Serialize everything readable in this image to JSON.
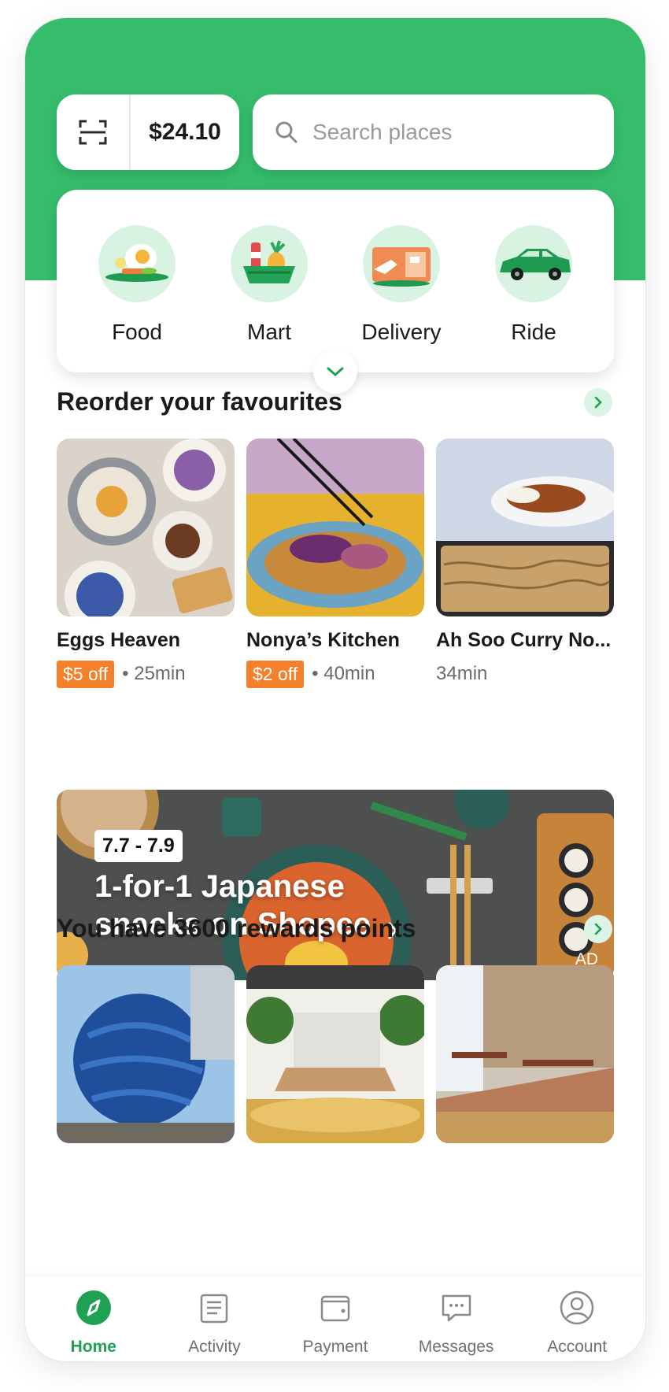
{
  "header": {
    "wallet_balance": "$24.10",
    "search_placeholder": "Search places"
  },
  "services": [
    {
      "label": "Food",
      "icon": "food-icon"
    },
    {
      "label": "Mart",
      "icon": "mart-icon"
    },
    {
      "label": "Delivery",
      "icon": "delivery-icon"
    },
    {
      "label": "Ride",
      "icon": "car-icon"
    }
  ],
  "reorder": {
    "title": "Reorder your favourites",
    "cards": [
      {
        "name": "Eggs Heaven",
        "promo": "$5 off",
        "eta": "25min"
      },
      {
        "name": "Nonya’s Kitchen",
        "promo": "$2 off",
        "eta": "40min"
      },
      {
        "name": "Ah Soo Curry No...",
        "eta": "34min"
      }
    ]
  },
  "banner": {
    "date": "7.7 - 7.9",
    "title_line1": "1-for-1 Japanese",
    "title_line2": "snacks on Shopee",
    "ad_label": "AD"
  },
  "rewards": {
    "title": "You have 3600 rewards points"
  },
  "nav": [
    {
      "label": "Home",
      "icon": "compass-icon",
      "active": true
    },
    {
      "label": "Activity",
      "icon": "activity-icon"
    },
    {
      "label": "Payment",
      "icon": "wallet-icon"
    },
    {
      "label": "Messages",
      "icon": "chat-icon"
    },
    {
      "label": "Account",
      "icon": "account-icon"
    }
  ],
  "colors": {
    "brand_green": "#35bd6c",
    "active_green": "#1fa153",
    "promo_orange": "#f4802c"
  }
}
